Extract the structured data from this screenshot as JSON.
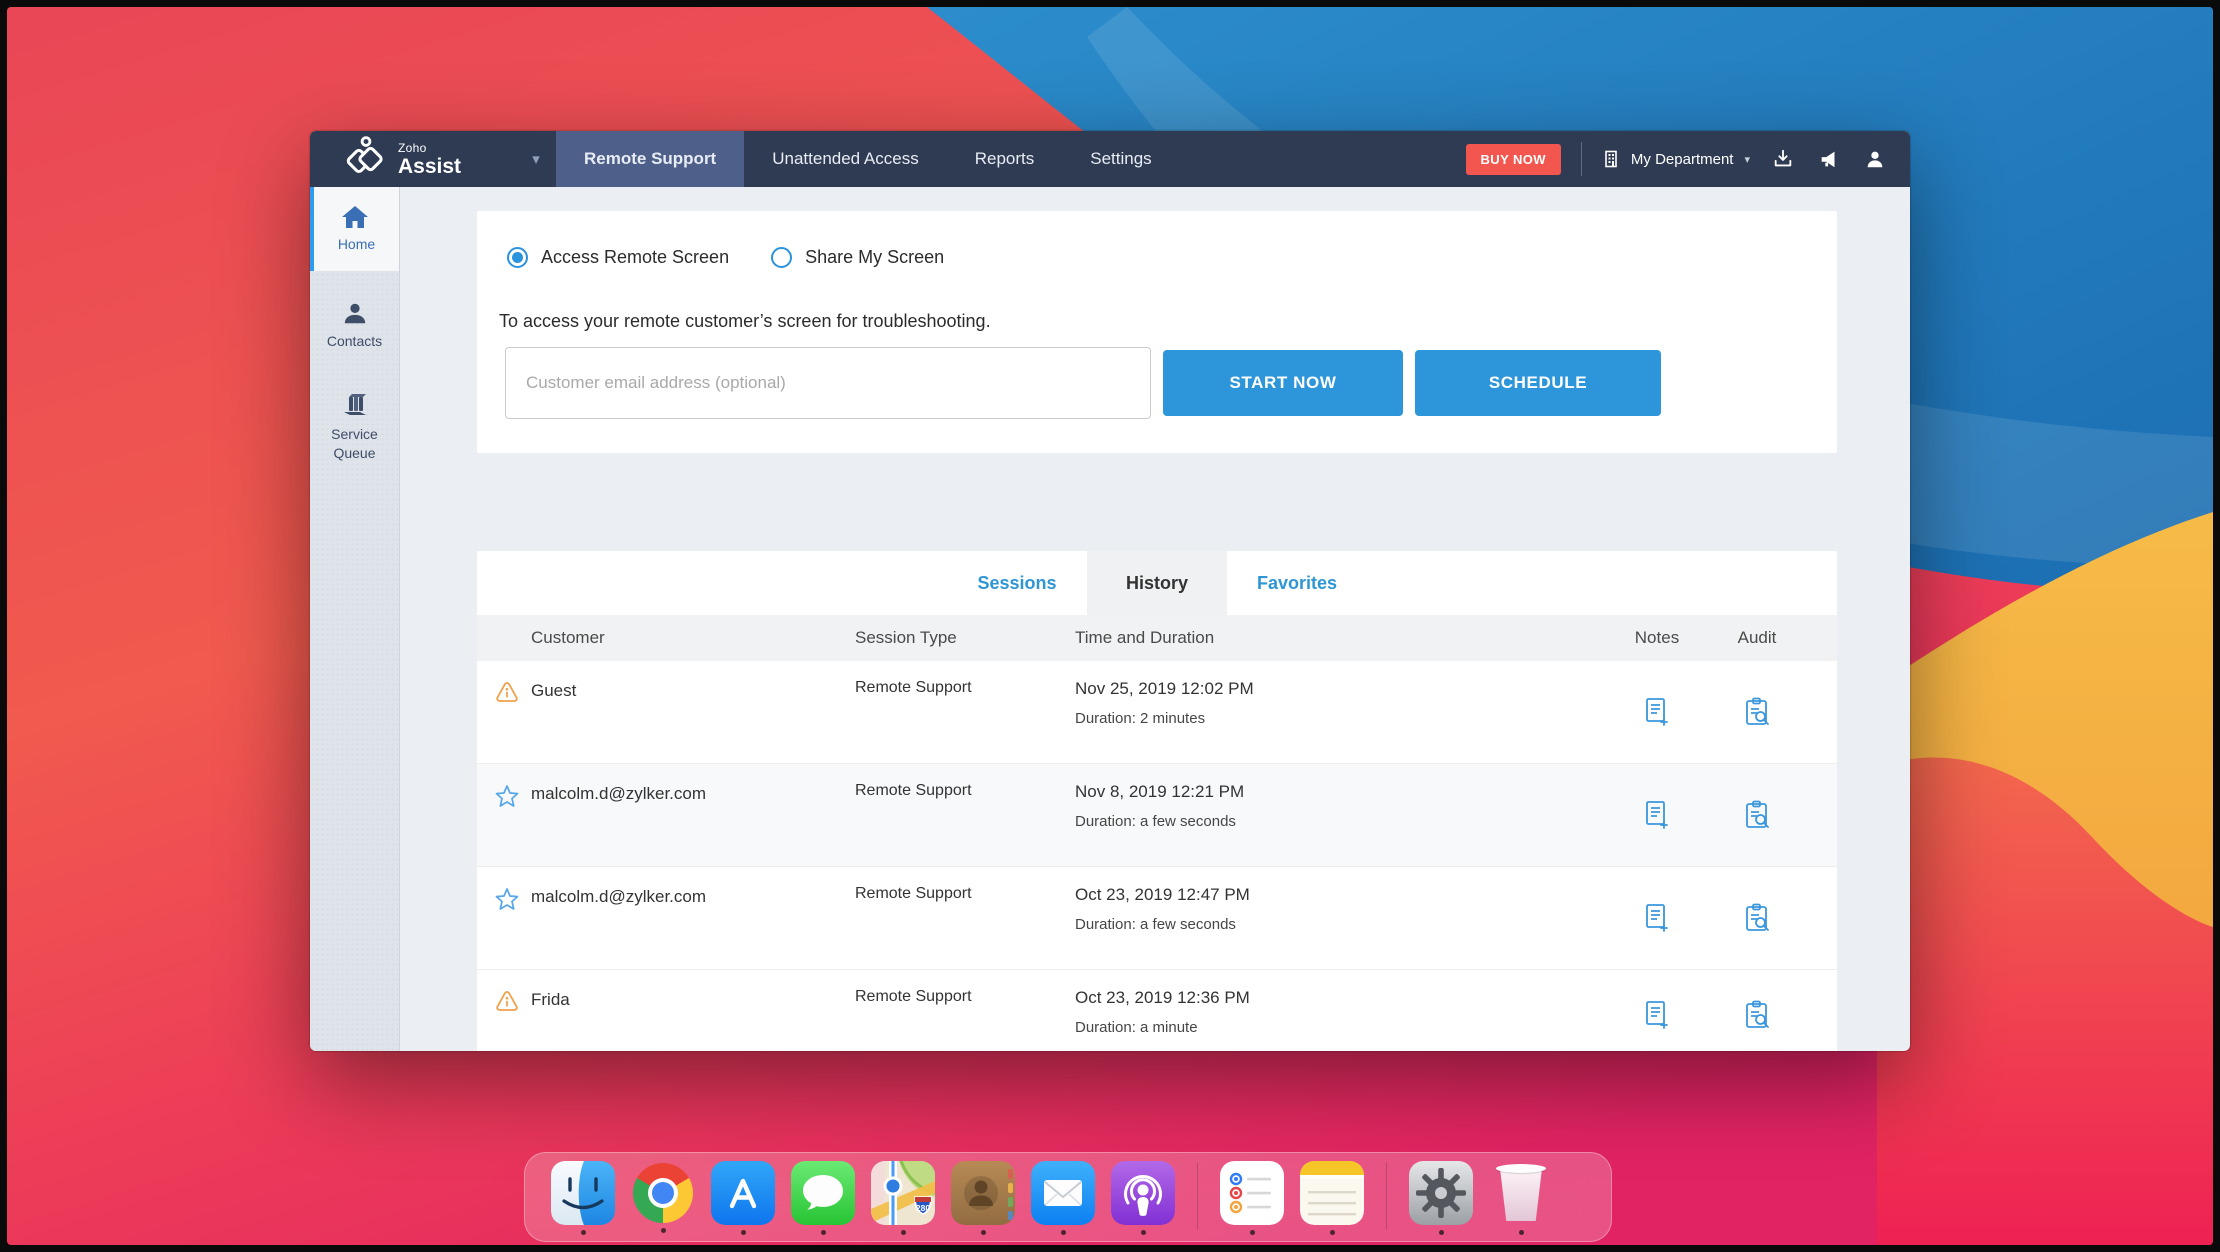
{
  "window": {
    "navbar": {
      "brand_top": "Zoho",
      "brand_bottom": "Assist",
      "tabs": [
        {
          "label": "Remote Support",
          "active": true
        },
        {
          "label": "Unattended Access",
          "active": false
        },
        {
          "label": "Reports",
          "active": false
        },
        {
          "label": "Settings",
          "active": false
        }
      ],
      "buy_now_label": "BUY NOW",
      "department_label": "My Department"
    },
    "sidebar": {
      "items": [
        {
          "label": "Home",
          "active": true
        },
        {
          "label": "Contacts",
          "active": false
        },
        {
          "label": "Service Queue",
          "active": false
        }
      ]
    },
    "session_card": {
      "radio_access_label": "Access Remote Screen",
      "radio_share_label": "Share My Screen",
      "selected_radio": "Access Remote Screen",
      "description": "To access your remote customer’s screen for troubleshooting.",
      "email_placeholder": "Customer email address (optional)",
      "start_label": "START NOW",
      "schedule_label": "SCHEDULE"
    },
    "history_card": {
      "tabs": [
        {
          "label": "Sessions",
          "active": false
        },
        {
          "label": "History",
          "active": true
        },
        {
          "label": "Favorites",
          "active": false
        }
      ],
      "columns": [
        "Customer",
        "Session Type",
        "Time and Duration",
        "Notes",
        "Audit"
      ],
      "rows": [
        {
          "icon": "alert",
          "customer": "Guest",
          "session_type": "Remote Support",
          "time": "Nov 25, 2019 12:02 PM",
          "duration": "Duration: 2 minutes"
        },
        {
          "icon": "star",
          "customer": "malcolm.d@zylker.com",
          "session_type": "Remote Support",
          "time": "Nov 8, 2019 12:21 PM",
          "duration": "Duration: a few seconds"
        },
        {
          "icon": "star",
          "customer": "malcolm.d@zylker.com",
          "session_type": "Remote Support",
          "time": "Oct 23, 2019 12:47 PM",
          "duration": "Duration: a few seconds"
        },
        {
          "icon": "alert",
          "customer": "Frida",
          "session_type": "Remote Support",
          "time": "Oct 23, 2019 12:36 PM",
          "duration": "Duration: a minute"
        }
      ]
    }
  },
  "dock": {
    "apps": [
      "finder",
      "chrome",
      "app-store",
      "messages",
      "maps",
      "contacts",
      "mail",
      "podcasts",
      "reminders",
      "notes",
      "system-preferences",
      "trash"
    ]
  },
  "colors": {
    "navbar": "#2e3b52",
    "nav_active_tab": "#4e6089",
    "buy_now": "#f2564e",
    "primary_button": "#2d96da",
    "link_blue": "#2e96d5",
    "alert_orange": "#f0a14b",
    "star_blue": "#56a6e8",
    "sidebar_active_accent": "#2e9bf0"
  }
}
